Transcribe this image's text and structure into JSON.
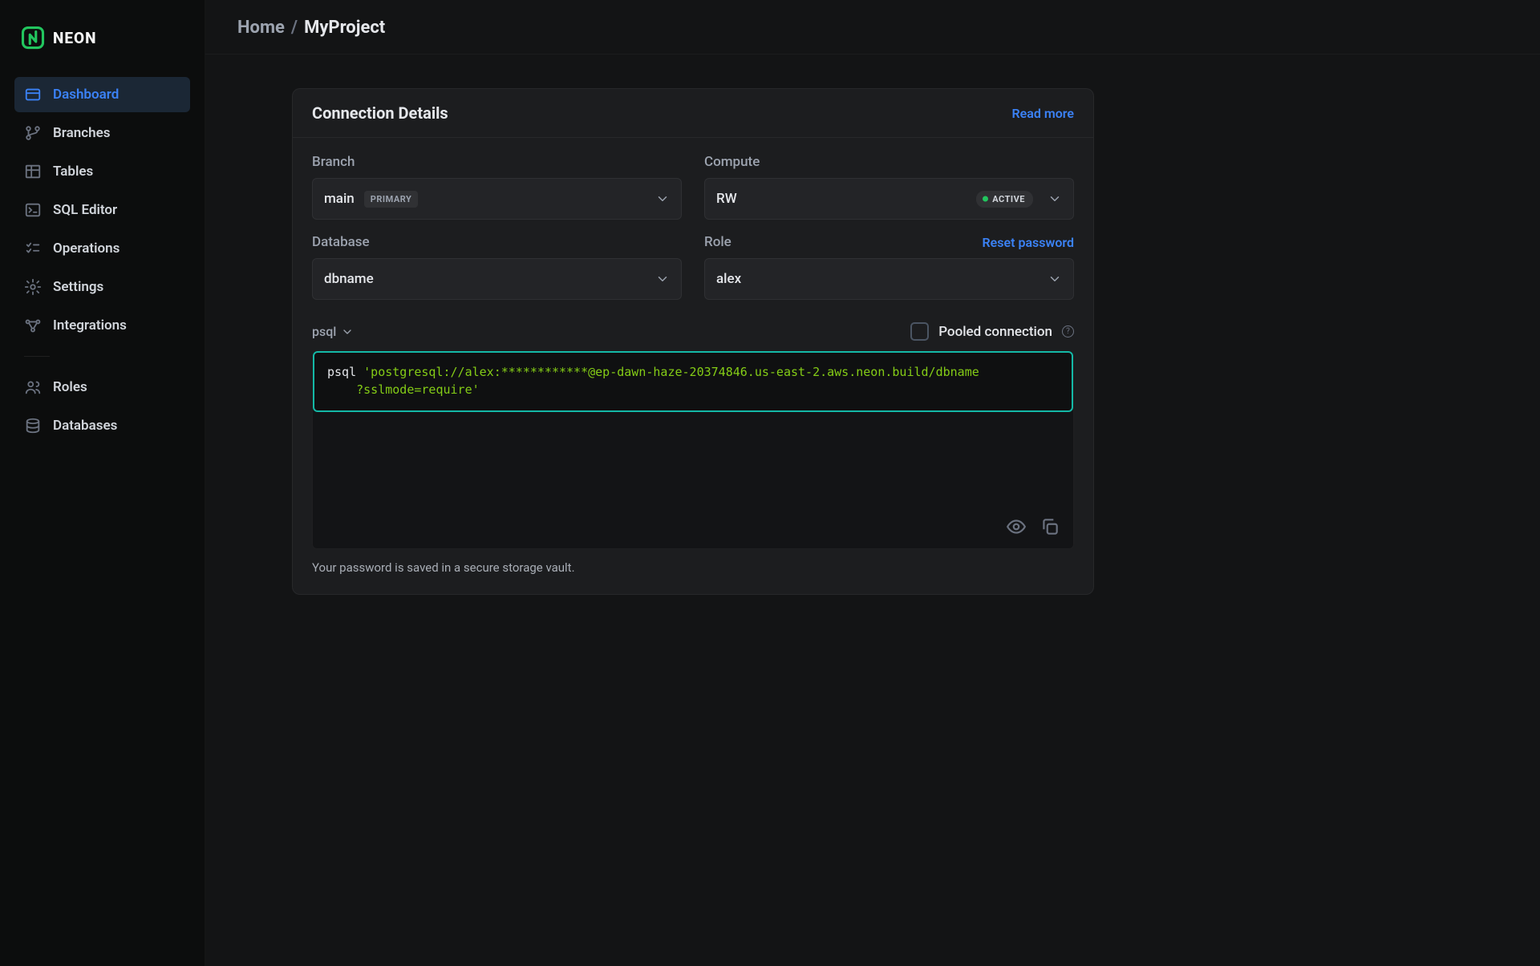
{
  "brand": {
    "name": "NEON"
  },
  "breadcrumb": {
    "home": "Home",
    "project": "MyProject"
  },
  "sidebar": {
    "items": [
      {
        "label": "Dashboard"
      },
      {
        "label": "Branches"
      },
      {
        "label": "Tables"
      },
      {
        "label": "SQL Editor"
      },
      {
        "label": "Operations"
      },
      {
        "label": "Settings"
      },
      {
        "label": "Integrations"
      },
      {
        "label": "Roles"
      },
      {
        "label": "Databases"
      }
    ]
  },
  "panel": {
    "title": "Connection Details",
    "read_more": "Read more",
    "branch": {
      "label": "Branch",
      "value": "main",
      "badge": "PRIMARY"
    },
    "compute": {
      "label": "Compute",
      "value": "RW",
      "status": "ACTIVE"
    },
    "database": {
      "label": "Database",
      "value": "dbname"
    },
    "role": {
      "label": "Role",
      "value": "alex",
      "reset": "Reset password"
    },
    "format_selector": "psql",
    "pooled": {
      "label": "Pooled connection",
      "checked": false
    },
    "code": {
      "cmd": "psql ",
      "line1": "'postgresql://alex:************@ep-dawn-haze-20374846.us-east-2.aws.neon.build/dbname",
      "line2": "    ?sslmode=require'"
    },
    "footnote": "Your password is saved in a secure storage vault."
  }
}
